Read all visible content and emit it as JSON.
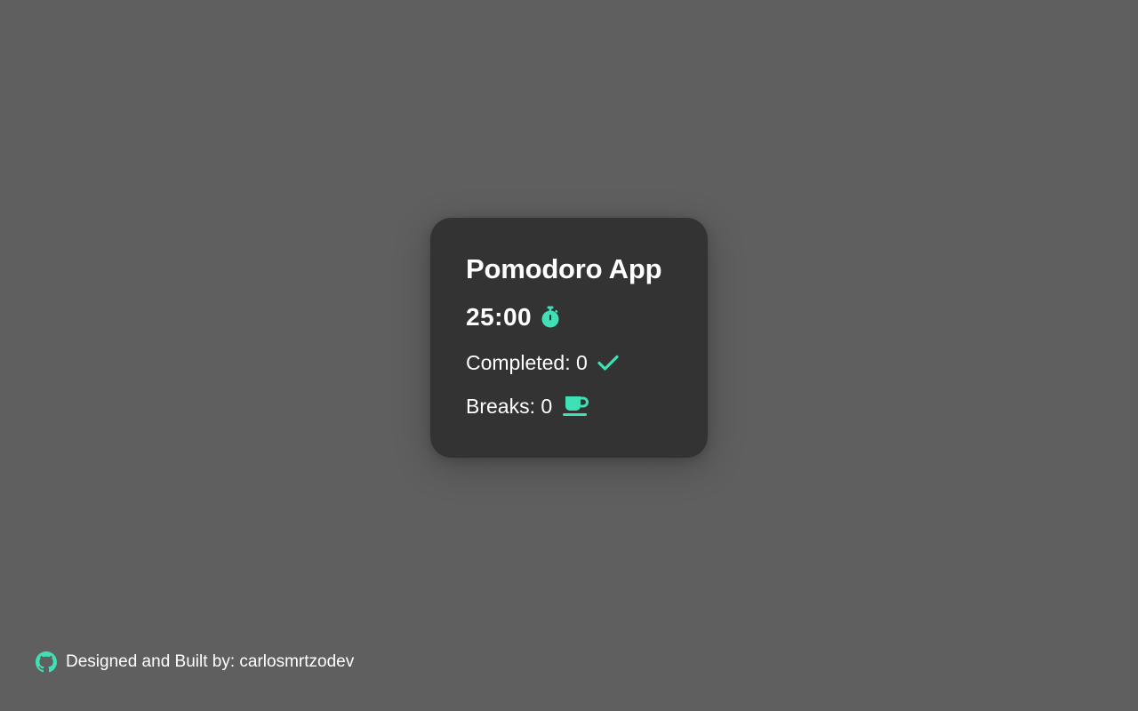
{
  "app": {
    "title": "Pomodoro App"
  },
  "timer": {
    "display": "25:00",
    "icon": "stopwatch-icon"
  },
  "stats": {
    "completed_label": "Completed:",
    "completed_value": "0",
    "completed_icon": "check-icon",
    "breaks_label": "Breaks:",
    "breaks_value": "0",
    "breaks_icon": "coffee-cup-icon"
  },
  "footer": {
    "text": "Designed and Built by: carlosmrtzodev",
    "icon": "github-icon"
  },
  "colors": {
    "background": "#5f5f5f",
    "card": "#333333",
    "accent": "#3fe0b5",
    "text": "#ffffff"
  }
}
